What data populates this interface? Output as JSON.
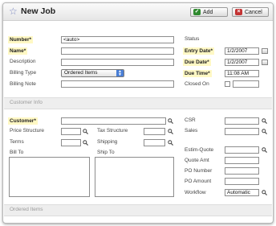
{
  "window": {
    "title": "New Job",
    "add_label": "Add",
    "cancel_label": "Cancel"
  },
  "top_left": {
    "number_label": "Number*",
    "number_value": "<auto>",
    "name_label": "Name*",
    "description_label": "Description",
    "billing_type_label": "Billing Type",
    "billing_type_value": "Ordered Items",
    "billing_note_label": "Billing Note"
  },
  "top_right": {
    "status_label": "Status",
    "entry_date_label": "Entry Date*",
    "entry_date_value": "1/2/2007",
    "due_date_label": "Due Date*",
    "due_date_value": "1/2/2007",
    "due_time_label": "Due Time*",
    "due_time_value": "11:08 AM",
    "closed_on_label": "Closed On"
  },
  "customer_section": {
    "heading": "Customer Info",
    "customer_label": "Customer*",
    "price_structure_label": "Price Structure",
    "tax_structure_label": "Tax Structure",
    "terms_label": "Terms",
    "shipping_label": "Shipping",
    "bill_to_label": "Bill To",
    "ship_to_label": "Ship To",
    "csr_label": "CSR",
    "sales_label": "Sales",
    "estim_quote_label": "Estim-Quote",
    "quote_amt_label": "Quote Amt",
    "po_number_label": "PO Number",
    "po_amount_label": "PO Amount",
    "workflow_label": "Workflow",
    "workflow_value": "Automatic"
  },
  "ordered_items": {
    "heading": "Ordered Items"
  },
  "icons": {
    "title_icon": "star-icon",
    "add_icon": "check-icon",
    "cancel_icon": "x-icon",
    "lookup_icon": "magnifier-icon",
    "calendar_icon": "calendar-icon"
  },
  "colors": {
    "required_highlight": "#fff8c4",
    "select_arrow": "#4a7fd6",
    "add_icon": "#2f8a2f",
    "cancel_icon": "#c33333"
  }
}
